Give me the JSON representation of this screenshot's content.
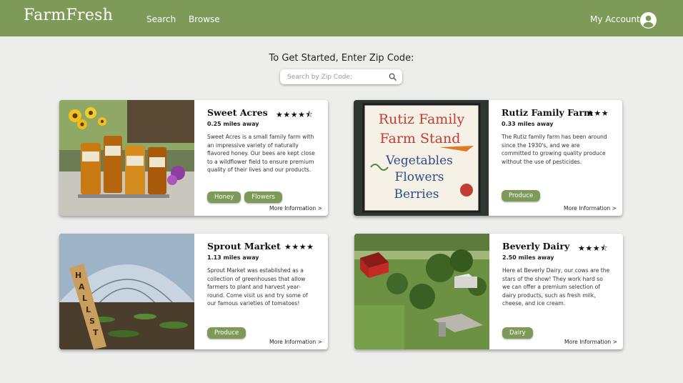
{
  "header": {
    "logo": "FarmFresh",
    "nav": {
      "search": "Search",
      "browse": "Browse"
    },
    "account_label": "My Account",
    "bg_color": "#7d9a59"
  },
  "search": {
    "heading": "To Get Started, Enter Zip Code:",
    "placeholder": "Search by Zip Code:"
  },
  "farms": [
    {
      "name": "Sweet Acres",
      "rating": 4.5,
      "stars": "★★★★⯪",
      "distance": "0.25 miles away",
      "description": "Sweet Acres is a small family farm with an impressive variety of naturally flavored honey. Our bees are kept close to a wildflower field to ensure premium quality of their lives and our products.",
      "tags": [
        "Honey",
        "Flowers"
      ],
      "more": "More Information >"
    },
    {
      "name": "Rutiz Family Farm",
      "rating": 3,
      "stars": "★★★",
      "distance": "0.33 miles away",
      "description": "The Rutiz family farm has been around since the 1930's, and we are committed to growing quality produce without the use of pesticides.",
      "tags": [
        "Produce"
      ],
      "more": "More Information >",
      "sign_lines": [
        "Rutiz Family",
        "Farm Stand",
        "Vegetables",
        "Flowers",
        "Berries"
      ]
    },
    {
      "name": "Sprout Market",
      "rating": 4,
      "stars": "★★★★",
      "distance": "1.13 miles away",
      "description": "Sprout Market was established as a collection of greenhouses that allow farmers to plant and harvest year-round. Come visit us and try some of our famous varieties of tomatoes!",
      "tags": [
        "Produce"
      ],
      "more": "More Information >"
    },
    {
      "name": "Beverly Dairy",
      "rating": 3.5,
      "stars": "★★★⯪",
      "distance": "2.50 miles away",
      "description": "Here at Beverly Dairy, our cows are the stars of the show! They work hard so we can offer a premium selection of dairy products, such as fresh milk, cheese, and ice cream.",
      "tags": [
        "Dairy"
      ],
      "more": "More Information >"
    }
  ]
}
